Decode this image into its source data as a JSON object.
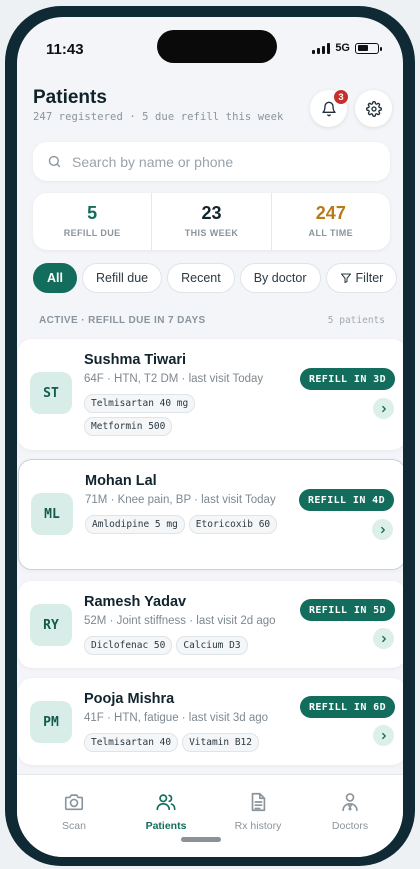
{
  "status": {
    "time": "11:43",
    "network": "5G"
  },
  "header": {
    "title": "Patients",
    "subtitle": "247 registered · 5 due refill this week",
    "notification_count": "3"
  },
  "search": {
    "placeholder": "Search by name or phone"
  },
  "stats": [
    {
      "value": "5",
      "label": "REFILL DUE",
      "color": "#136d5c"
    },
    {
      "value": "23",
      "label": "THIS WEEK",
      "color": "#12242d"
    },
    {
      "value": "247",
      "label": "ALL TIME",
      "color": "#b87a15"
    }
  ],
  "filters": [
    "All",
    "Refill due",
    "Recent",
    "By doctor",
    "Filter"
  ],
  "section": {
    "label": "ACTIVE · REFILL DUE IN 7 DAYS",
    "count": "5 patients"
  },
  "patients": [
    {
      "initials": "ST",
      "name": "Sushma Tiwari",
      "meta": "64F · HTN, T2 DM · last visit Today",
      "meds": [
        "Telmisartan 40 mg",
        "Metformin 500"
      ],
      "refill": "REFILL IN 3D"
    },
    {
      "initials": "ML",
      "name": "Mohan Lal",
      "meta": "71M · Knee pain, BP · last visit Today",
      "meds": [
        "Amlodipine 5 mg",
        "Etoricoxib 60"
      ],
      "refill": "REFILL IN 4D"
    },
    {
      "initials": "RY",
      "name": "Ramesh Yadav",
      "meta": "52M · Joint stiffness · last visit 2d ago",
      "meds": [
        "Diclofenac 50",
        "Calcium D3"
      ],
      "refill": "REFILL IN 5D"
    },
    {
      "initials": "PM",
      "name": "Pooja Mishra",
      "meta": "41F · HTN, fatigue · last visit 3d ago",
      "meds": [
        "Telmisartan 40",
        "Vitamin B12"
      ],
      "refill": "REFILL IN 6D"
    }
  ],
  "tabs": [
    {
      "label": "Scan",
      "icon": "camera-icon"
    },
    {
      "label": "Patients",
      "icon": "users-icon"
    },
    {
      "label": "Rx history",
      "icon": "document-icon"
    },
    {
      "label": "Doctors",
      "icon": "doctor-icon"
    }
  ],
  "colors": {
    "accent": "#136d5c",
    "badge": "#c6302b",
    "amber": "#b87a15"
  }
}
